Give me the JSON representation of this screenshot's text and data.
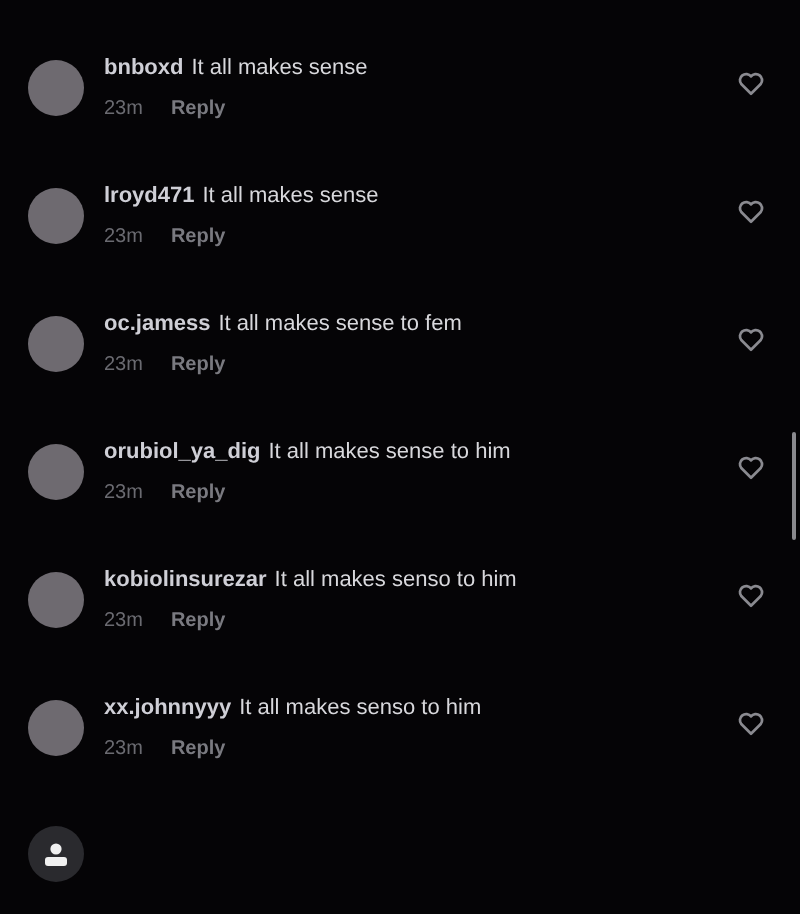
{
  "comments": [
    {
      "username": "bnboxd",
      "text": "It all makes sense",
      "time": "23m",
      "reply": "Reply"
    },
    {
      "username": "lroyd471",
      "text": "It all makes sense",
      "time": "23m",
      "reply": "Reply"
    },
    {
      "username": "oc.jamess",
      "text": "It all makes sense to fem",
      "time": "23m",
      "reply": "Reply"
    },
    {
      "username": "orubiol_ya_dig",
      "text": "It all makes sense to him",
      "time": "23m",
      "reply": "Reply"
    },
    {
      "username": "kobiolinsurezar",
      "text": "It all makes senso to him",
      "time": "23m",
      "reply": "Reply"
    },
    {
      "username": "xx.johnnyyy",
      "text": "It all makes senso to him",
      "time": "23m",
      "reply": "Reply"
    }
  ]
}
